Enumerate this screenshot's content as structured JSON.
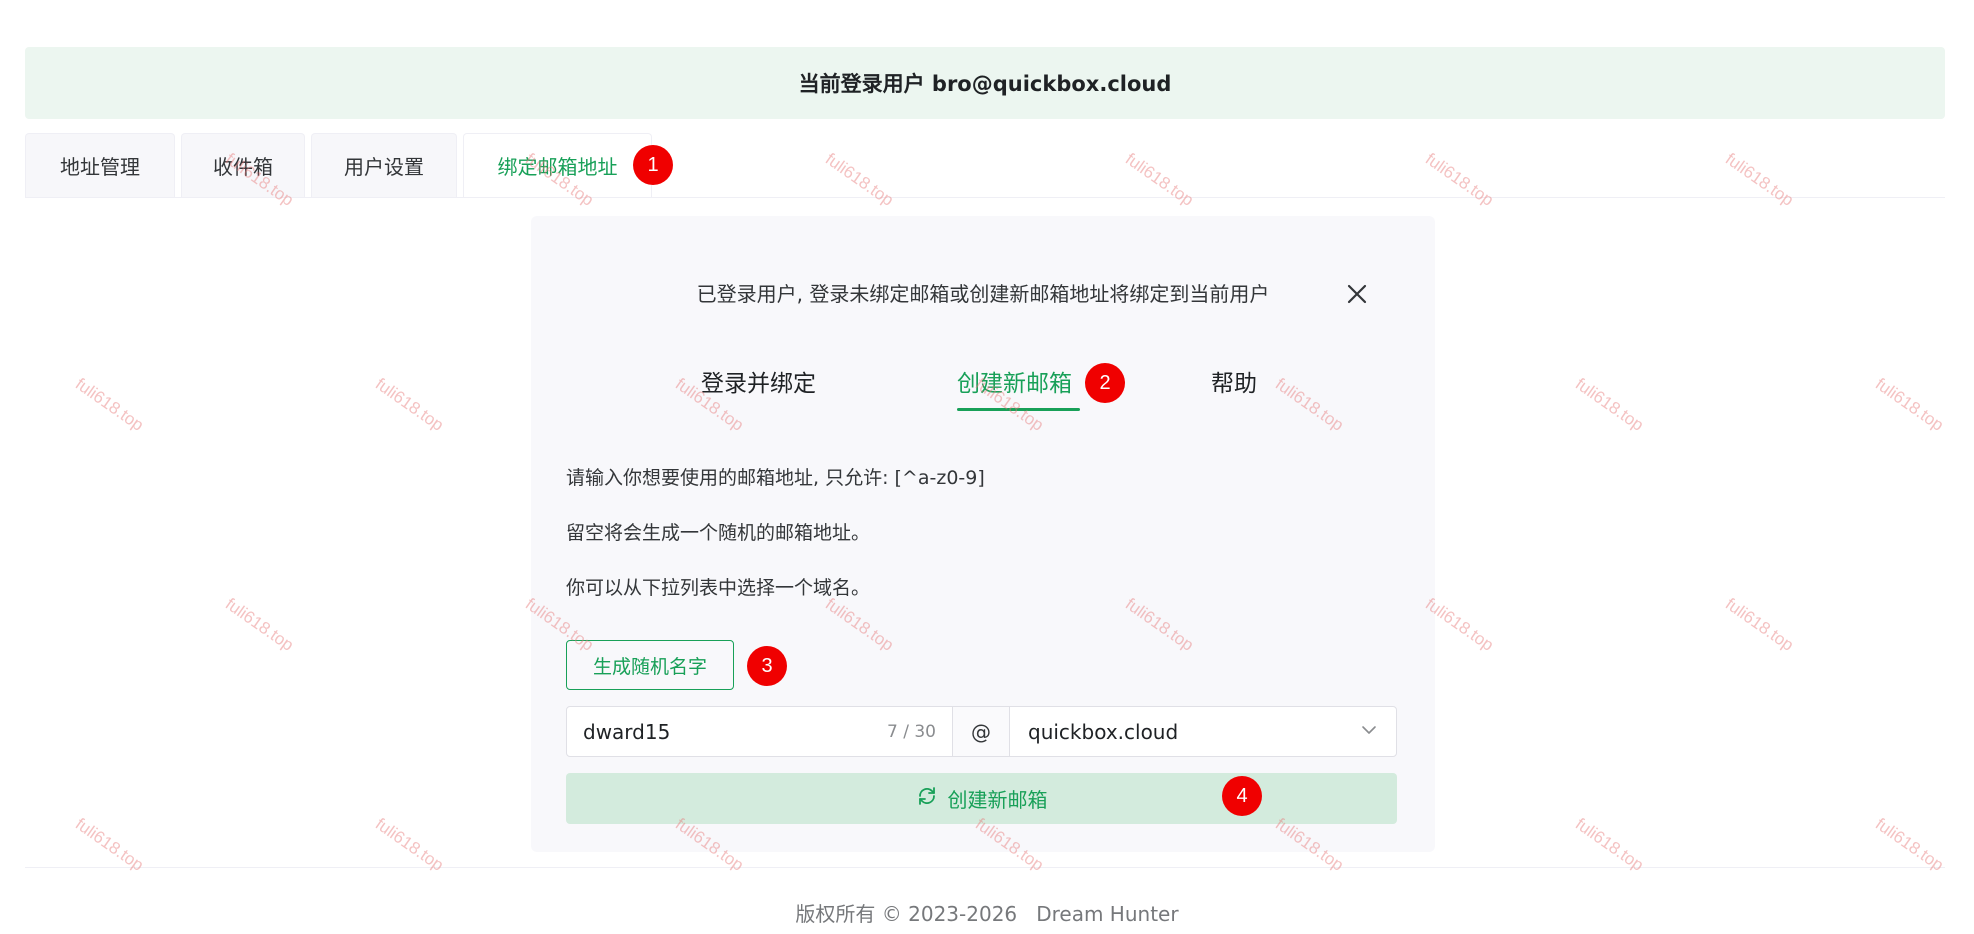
{
  "banner": {
    "text": "当前登录用户 bro@quickbox.cloud"
  },
  "tabs": [
    {
      "label": "地址管理"
    },
    {
      "label": "收件箱"
    },
    {
      "label": "用户设置"
    },
    {
      "label": "绑定邮箱地址",
      "active": true
    }
  ],
  "annotations": [
    "1",
    "2",
    "3",
    "4"
  ],
  "dialog": {
    "title": "已登录用户, 登录未绑定邮箱或创建新邮箱地址将绑定到当前用户",
    "close_icon": "close-icon",
    "tabs": [
      {
        "label": "登录并绑定"
      },
      {
        "label": "创建新邮箱",
        "active": true
      },
      {
        "label": "帮助"
      }
    ],
    "desc": [
      "请输入你想要使用的邮箱地址, 只允许: [^a-z0-9]",
      "留空将会生成一个随机的邮箱地址。",
      "你可以从下拉列表中选择一个域名。"
    ],
    "random_button": "生成随机名字",
    "name_input": {
      "value": "dward15",
      "count": "7 / 30"
    },
    "at_symbol": "@",
    "domain_select": {
      "value": "quickbox.cloud",
      "icon": "chevron-down-icon"
    },
    "create_button": {
      "label": "创建新邮箱",
      "icon": "refresh-icon"
    }
  },
  "footer": {
    "text": "版权所有 © 2023-2026   Dream Hunter"
  },
  "watermark": {
    "text": "fuli618.top"
  },
  "colors": {
    "accent": "#18a058",
    "banner_bg": "#ecf6f0",
    "badge": "#f00000",
    "card_bg": "#f8f8fb"
  }
}
